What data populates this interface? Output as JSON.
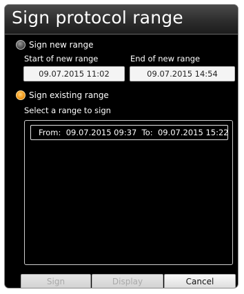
{
  "dialog": {
    "title": "Sign protocol range"
  },
  "new_range": {
    "option_label": "Sign new range",
    "selected": false,
    "start_label": "Start of new range",
    "start_value": "09.07.2015 11:02",
    "end_label": "End of new range",
    "end_value": "09.07.2015 14:54"
  },
  "existing_range": {
    "option_label": "Sign existing range",
    "selected": true,
    "list_label": "Select a range to sign",
    "items": [
      {
        "from_label": "From:",
        "from_value": "09.07.2015 09:37",
        "to_label": "To:",
        "to_value": "09.07.2015 15:22"
      }
    ]
  },
  "buttons": {
    "sign": "Sign",
    "display": "Display",
    "cancel": "Cancel"
  },
  "colors": {
    "background": "#000000",
    "accent_radio": "#f39a1a",
    "field_background": "#f4f4f4"
  }
}
